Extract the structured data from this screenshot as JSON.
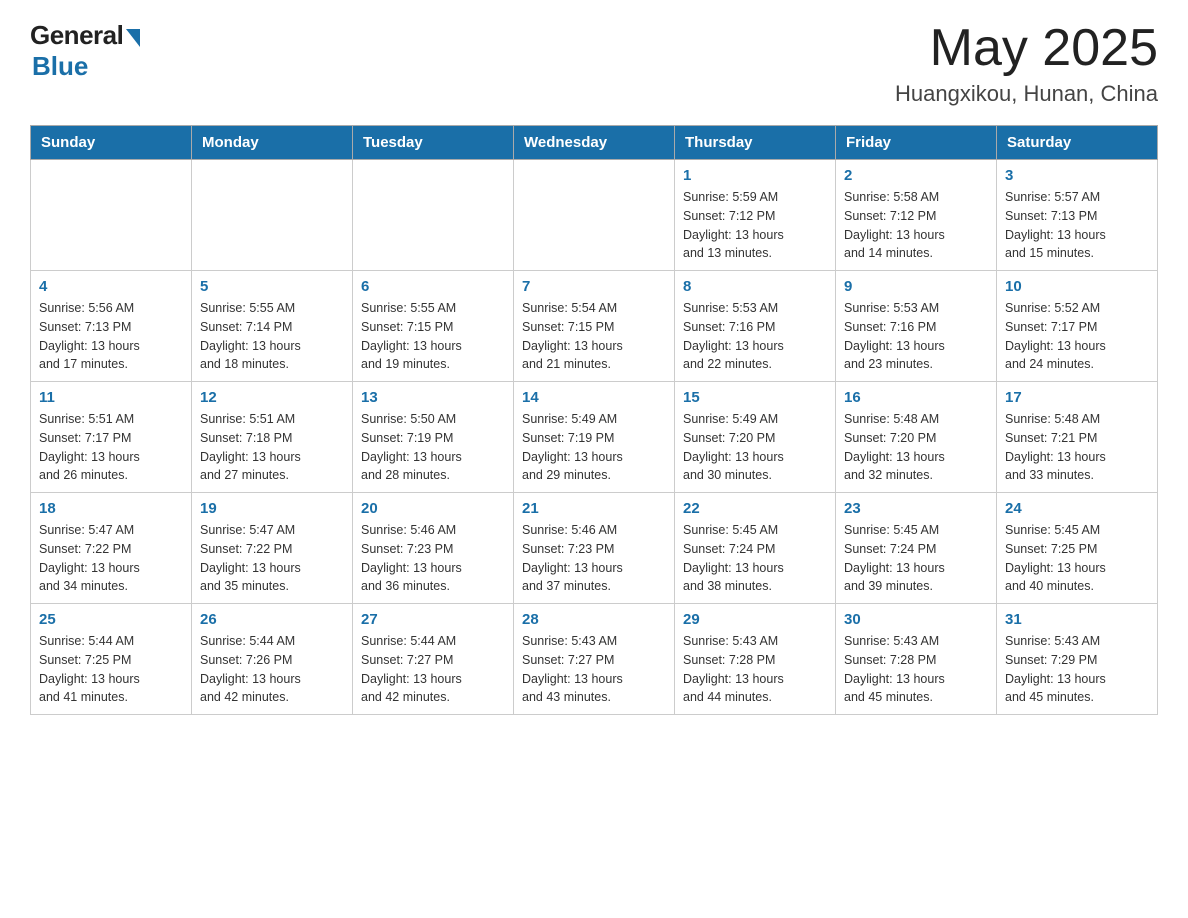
{
  "logo": {
    "general": "General",
    "blue": "Blue"
  },
  "title": {
    "month_year": "May 2025",
    "location": "Huangxikou, Hunan, China"
  },
  "weekdays": [
    "Sunday",
    "Monday",
    "Tuesday",
    "Wednesday",
    "Thursday",
    "Friday",
    "Saturday"
  ],
  "weeks": [
    [
      {
        "day": "",
        "info": ""
      },
      {
        "day": "",
        "info": ""
      },
      {
        "day": "",
        "info": ""
      },
      {
        "day": "",
        "info": ""
      },
      {
        "day": "1",
        "info": "Sunrise: 5:59 AM\nSunset: 7:12 PM\nDaylight: 13 hours\nand 13 minutes."
      },
      {
        "day": "2",
        "info": "Sunrise: 5:58 AM\nSunset: 7:12 PM\nDaylight: 13 hours\nand 14 minutes."
      },
      {
        "day": "3",
        "info": "Sunrise: 5:57 AM\nSunset: 7:13 PM\nDaylight: 13 hours\nand 15 minutes."
      }
    ],
    [
      {
        "day": "4",
        "info": "Sunrise: 5:56 AM\nSunset: 7:13 PM\nDaylight: 13 hours\nand 17 minutes."
      },
      {
        "day": "5",
        "info": "Sunrise: 5:55 AM\nSunset: 7:14 PM\nDaylight: 13 hours\nand 18 minutes."
      },
      {
        "day": "6",
        "info": "Sunrise: 5:55 AM\nSunset: 7:15 PM\nDaylight: 13 hours\nand 19 minutes."
      },
      {
        "day": "7",
        "info": "Sunrise: 5:54 AM\nSunset: 7:15 PM\nDaylight: 13 hours\nand 21 minutes."
      },
      {
        "day": "8",
        "info": "Sunrise: 5:53 AM\nSunset: 7:16 PM\nDaylight: 13 hours\nand 22 minutes."
      },
      {
        "day": "9",
        "info": "Sunrise: 5:53 AM\nSunset: 7:16 PM\nDaylight: 13 hours\nand 23 minutes."
      },
      {
        "day": "10",
        "info": "Sunrise: 5:52 AM\nSunset: 7:17 PM\nDaylight: 13 hours\nand 24 minutes."
      }
    ],
    [
      {
        "day": "11",
        "info": "Sunrise: 5:51 AM\nSunset: 7:17 PM\nDaylight: 13 hours\nand 26 minutes."
      },
      {
        "day": "12",
        "info": "Sunrise: 5:51 AM\nSunset: 7:18 PM\nDaylight: 13 hours\nand 27 minutes."
      },
      {
        "day": "13",
        "info": "Sunrise: 5:50 AM\nSunset: 7:19 PM\nDaylight: 13 hours\nand 28 minutes."
      },
      {
        "day": "14",
        "info": "Sunrise: 5:49 AM\nSunset: 7:19 PM\nDaylight: 13 hours\nand 29 minutes."
      },
      {
        "day": "15",
        "info": "Sunrise: 5:49 AM\nSunset: 7:20 PM\nDaylight: 13 hours\nand 30 minutes."
      },
      {
        "day": "16",
        "info": "Sunrise: 5:48 AM\nSunset: 7:20 PM\nDaylight: 13 hours\nand 32 minutes."
      },
      {
        "day": "17",
        "info": "Sunrise: 5:48 AM\nSunset: 7:21 PM\nDaylight: 13 hours\nand 33 minutes."
      }
    ],
    [
      {
        "day": "18",
        "info": "Sunrise: 5:47 AM\nSunset: 7:22 PM\nDaylight: 13 hours\nand 34 minutes."
      },
      {
        "day": "19",
        "info": "Sunrise: 5:47 AM\nSunset: 7:22 PM\nDaylight: 13 hours\nand 35 minutes."
      },
      {
        "day": "20",
        "info": "Sunrise: 5:46 AM\nSunset: 7:23 PM\nDaylight: 13 hours\nand 36 minutes."
      },
      {
        "day": "21",
        "info": "Sunrise: 5:46 AM\nSunset: 7:23 PM\nDaylight: 13 hours\nand 37 minutes."
      },
      {
        "day": "22",
        "info": "Sunrise: 5:45 AM\nSunset: 7:24 PM\nDaylight: 13 hours\nand 38 minutes."
      },
      {
        "day": "23",
        "info": "Sunrise: 5:45 AM\nSunset: 7:24 PM\nDaylight: 13 hours\nand 39 minutes."
      },
      {
        "day": "24",
        "info": "Sunrise: 5:45 AM\nSunset: 7:25 PM\nDaylight: 13 hours\nand 40 minutes."
      }
    ],
    [
      {
        "day": "25",
        "info": "Sunrise: 5:44 AM\nSunset: 7:25 PM\nDaylight: 13 hours\nand 41 minutes."
      },
      {
        "day": "26",
        "info": "Sunrise: 5:44 AM\nSunset: 7:26 PM\nDaylight: 13 hours\nand 42 minutes."
      },
      {
        "day": "27",
        "info": "Sunrise: 5:44 AM\nSunset: 7:27 PM\nDaylight: 13 hours\nand 42 minutes."
      },
      {
        "day": "28",
        "info": "Sunrise: 5:43 AM\nSunset: 7:27 PM\nDaylight: 13 hours\nand 43 minutes."
      },
      {
        "day": "29",
        "info": "Sunrise: 5:43 AM\nSunset: 7:28 PM\nDaylight: 13 hours\nand 44 minutes."
      },
      {
        "day": "30",
        "info": "Sunrise: 5:43 AM\nSunset: 7:28 PM\nDaylight: 13 hours\nand 45 minutes."
      },
      {
        "day": "31",
        "info": "Sunrise: 5:43 AM\nSunset: 7:29 PM\nDaylight: 13 hours\nand 45 minutes."
      }
    ]
  ]
}
